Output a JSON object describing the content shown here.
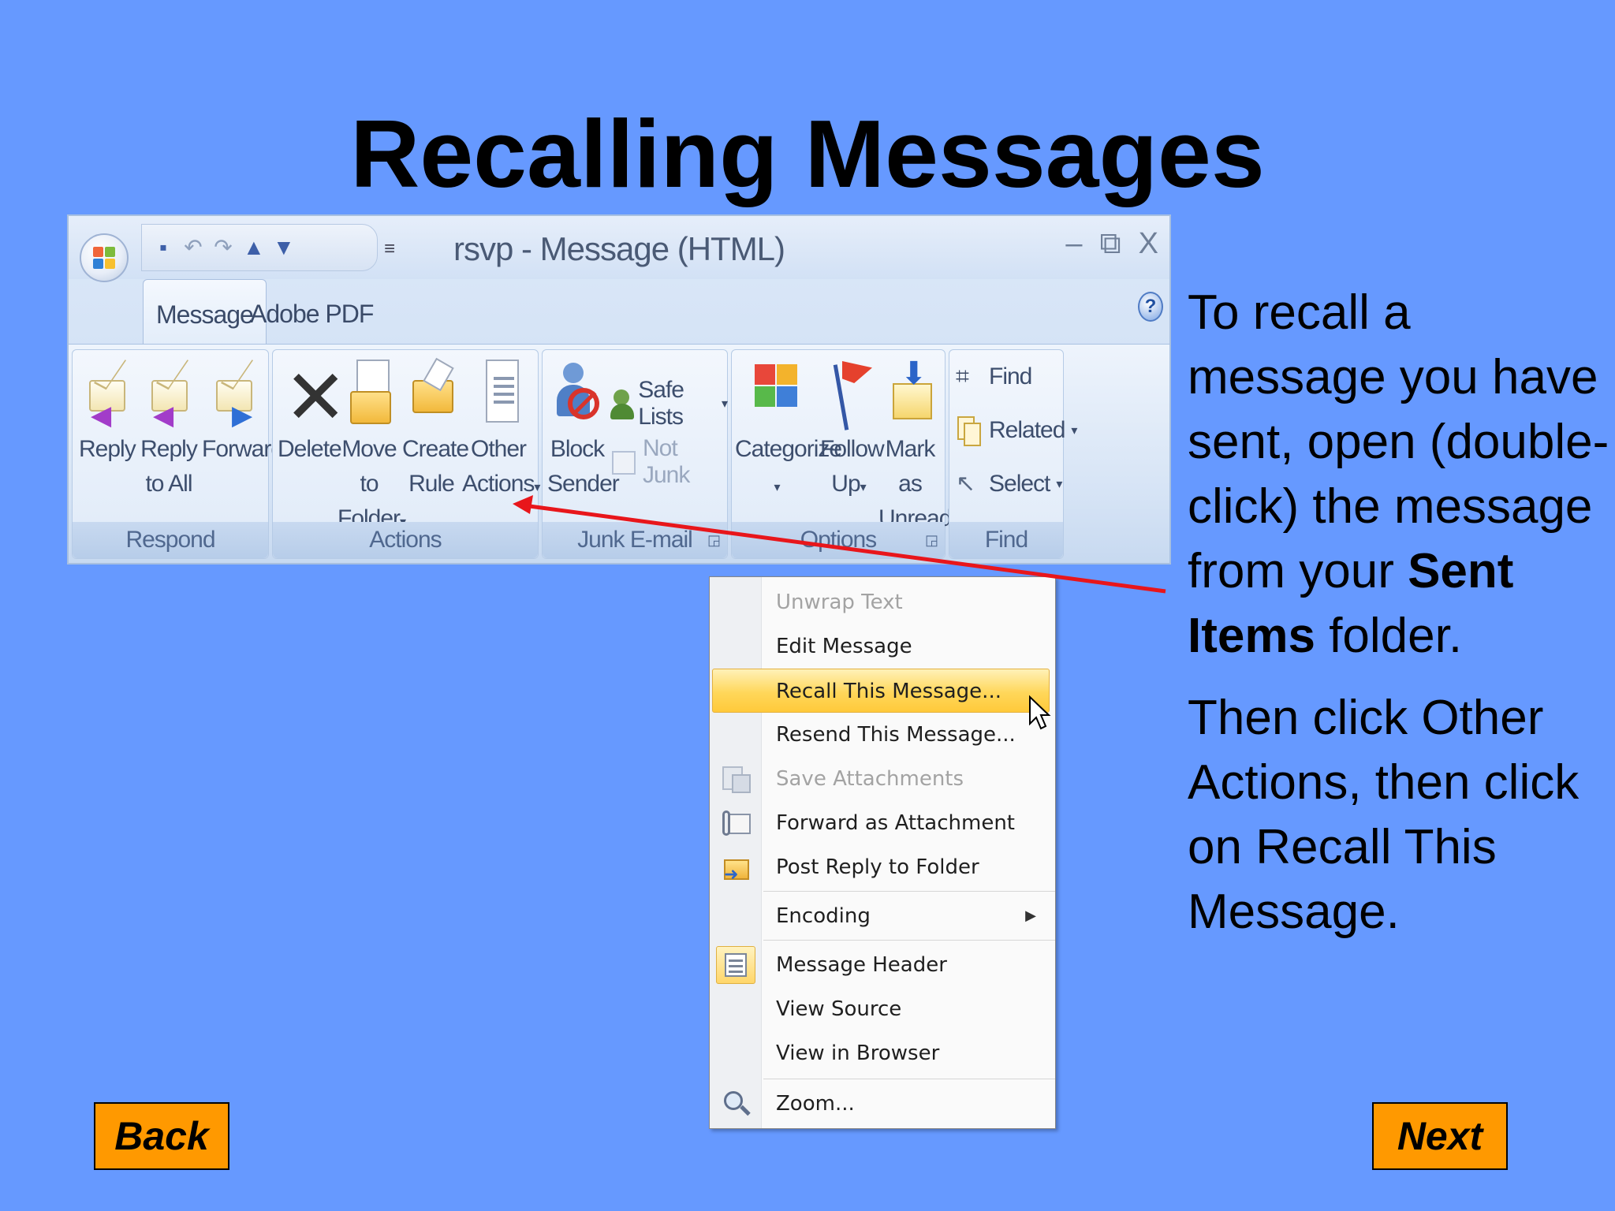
{
  "slide": {
    "title": "Recalling Messages"
  },
  "window": {
    "title": "rsvp - Message (HTML)",
    "controls": [
      "–",
      "⧉",
      "X"
    ],
    "tabs": [
      {
        "label": "Message",
        "active": true
      },
      {
        "label": "Adobe PDF",
        "active": false
      }
    ],
    "help_label": "?"
  },
  "ribbon": {
    "respond": {
      "label": "Respond",
      "reply": "Reply",
      "reply_all_1": "Reply",
      "reply_all_2": "to All",
      "forward": "Forward"
    },
    "actions": {
      "label": "Actions",
      "delete": "Delete",
      "move_1": "Move to",
      "move_2": "Folder",
      "create_1": "Create",
      "create_2": "Rule",
      "other_1": "Other",
      "other_2": "Actions"
    },
    "junk": {
      "label": "Junk E-mail",
      "block_1": "Block",
      "block_2": "Sender",
      "safe_lists": "Safe Lists",
      "not_junk": "Not Junk"
    },
    "options": {
      "label": "Options",
      "categorize": "Categorize",
      "follow_1": "Follow",
      "follow_2": "Up",
      "mark_1": "Mark as",
      "mark_2": "Unread"
    },
    "find": {
      "label": "Find",
      "find": "Find",
      "related": "Related",
      "select": "Select"
    },
    "dropdown_glyph": "▾"
  },
  "menu": {
    "unwrap": "Unwrap Text",
    "edit": "Edit Message",
    "recall": "Recall This Message...",
    "resend": "Resend This Message...",
    "save_attachments": "Save Attachments",
    "forward_attachment": "Forward as Attachment",
    "post_reply": "Post Reply to Folder",
    "encoding": "Encoding",
    "message_header": "Message Header",
    "view_source": "View Source",
    "view_browser": "View in Browser",
    "zoom": "Zoom...",
    "submenu_glyph": "▶"
  },
  "instructions": {
    "p1_before": "To recall a message you have sent, open (double-click) the message from your ",
    "p1_bold": "Sent Items",
    "p1_after": " folder.",
    "p2": "Then click Other Actions, then click on Recall This Message."
  },
  "nav": {
    "back": "Back",
    "next": "Next"
  },
  "colors": {
    "background": "#6699ff",
    "nav_button": "#ff9900",
    "arrow": "#e8161b",
    "highlight": "#ffd75a"
  }
}
